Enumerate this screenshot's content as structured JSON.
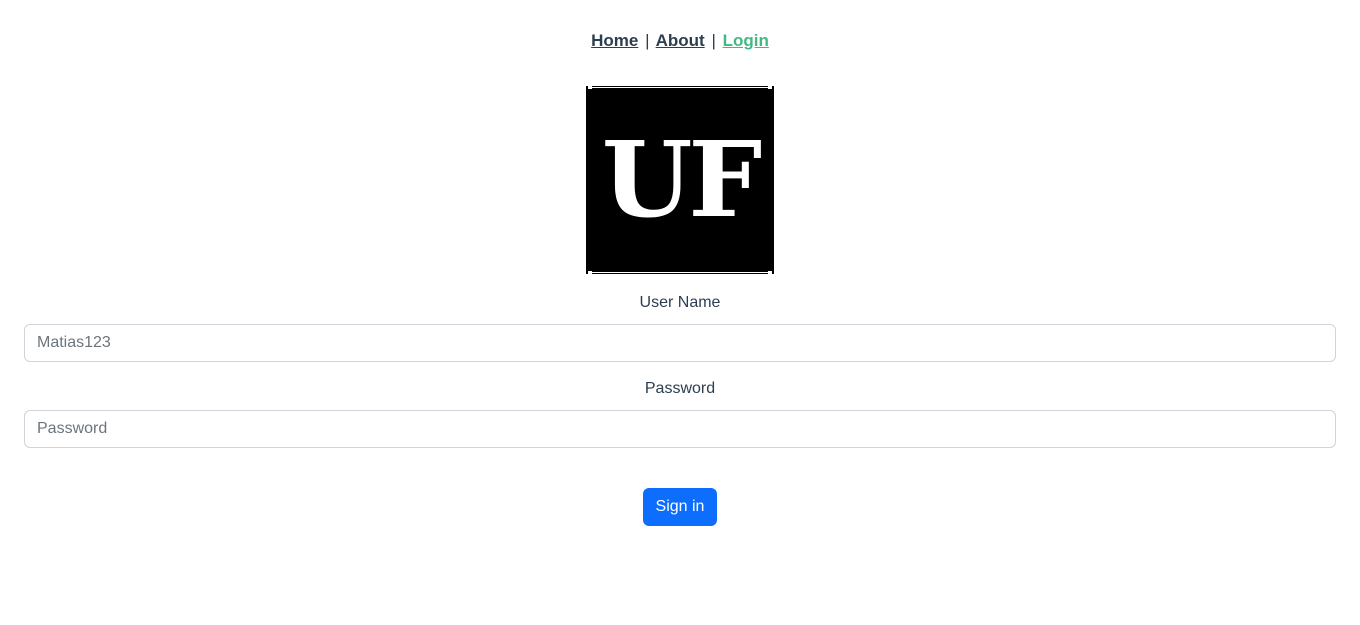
{
  "nav": {
    "home": "Home",
    "about": "About",
    "login": "Login",
    "separator": "|"
  },
  "logo": {
    "text": "UF"
  },
  "form": {
    "username_label": "User Name",
    "username_placeholder": "Matias123",
    "password_label": "Password",
    "password_placeholder": "Password",
    "submit_label": "Sign in"
  },
  "colors": {
    "text": "#2c3e50",
    "active_link": "#42b983",
    "primary_button": "#0d6efd",
    "input_border": "#ced4da",
    "logo_background": "#000000"
  }
}
